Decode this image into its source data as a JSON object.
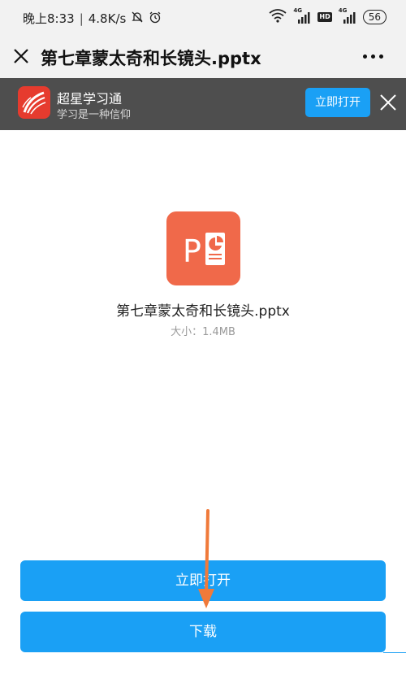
{
  "status_bar": {
    "time": "晚上8:33",
    "net_speed": "4.8K/s",
    "signal1_label": "4G",
    "hd_label": "HD",
    "signal2_label": "4G",
    "battery": "56"
  },
  "title_bar": {
    "title": "第七章蒙太奇和长镜头.pptx"
  },
  "banner": {
    "app_name": "超星学习通",
    "slogan": "学习是一种信仰",
    "open_label": "立即打开"
  },
  "file": {
    "icon_letter": "P",
    "name": "第七章蒙太奇和长镜头.pptx",
    "size_label": "大小：",
    "size_value": "1.4MB"
  },
  "actions": {
    "open_label": "立即打开",
    "download_label": "下载"
  },
  "colors": {
    "accent": "#1aa0f5",
    "banner_bg": "#4e4e4e",
    "ppt_icon": "#f0694a",
    "annotation_arrow": "#f07a3a"
  }
}
